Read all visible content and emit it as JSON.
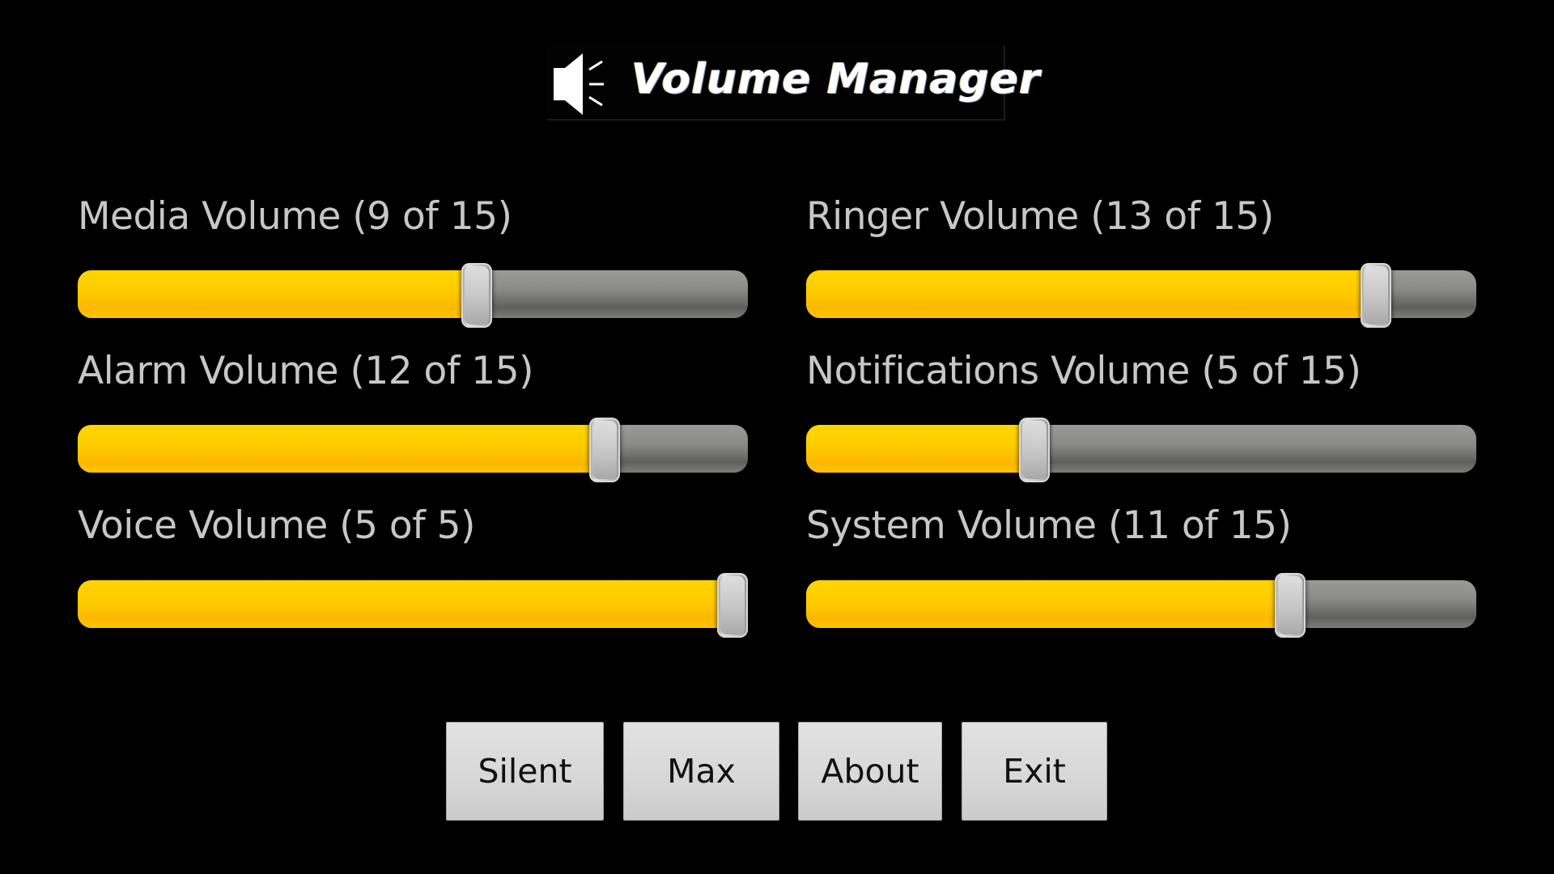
{
  "app": {
    "title": "Volume Manager",
    "logo_icon": "speaker-icon"
  },
  "sliders": [
    {
      "id": "media",
      "label": "Media Volume (9 of 15)",
      "value": 9,
      "max": 15
    },
    {
      "id": "ringer",
      "label": "Ringer Volume (13 of 15)",
      "value": 13,
      "max": 15
    },
    {
      "id": "alarm",
      "label": "Alarm Volume (12 of 15)",
      "value": 12,
      "max": 15
    },
    {
      "id": "notifications",
      "label": "Notifications Volume (5 of 15)",
      "value": 5,
      "max": 15
    },
    {
      "id": "voice",
      "label": "Voice Volume (5 of 5)",
      "value": 5,
      "max": 5
    },
    {
      "id": "system",
      "label": "System Volume (11 of 15)",
      "value": 11,
      "max": 15
    }
  ],
  "buttons": {
    "silent": "Silent",
    "max": "Max",
    "about": "About",
    "exit": "Exit"
  },
  "colors": {
    "background": "#000000",
    "fill": "#ffcc00",
    "track": "#7a7b79",
    "label": "#c7c7c7",
    "button": "#d8d8d8"
  }
}
